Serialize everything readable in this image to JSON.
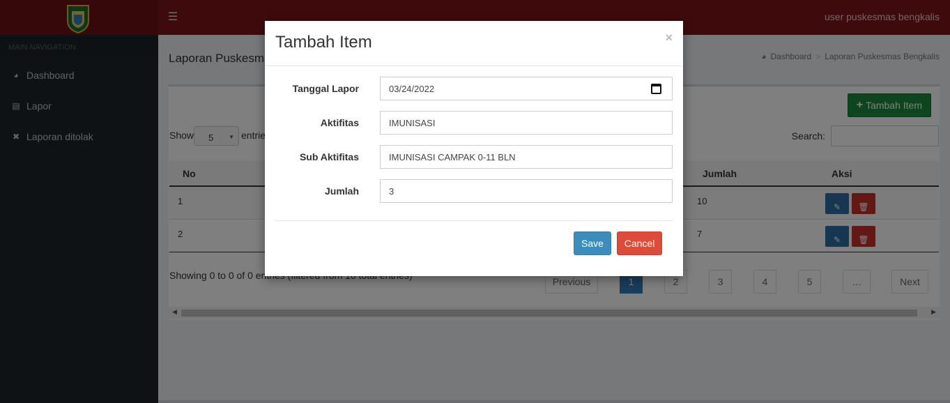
{
  "header": {
    "user_name": "user puskesmas bengkalis",
    "menu_icon": "hamburger-icon"
  },
  "sidebar": {
    "section_title": "MAIN NAVIGATION",
    "items": [
      {
        "label": "Dashboard",
        "icon": "dashboard-icon"
      },
      {
        "label": "Lapor",
        "icon": "newspaper-icon"
      },
      {
        "label": "Laporan ditolak",
        "icon": "close-icon"
      }
    ]
  },
  "content": {
    "title": "Laporan Puskesmas Bengkalis",
    "breadcrumb": [
      "Dashboard",
      "Laporan Puskesmas Bengkalis"
    ],
    "add_button": "Tambah Item",
    "show_label": "Show",
    "page_size": "5",
    "entries_label": "entries",
    "search_label": "Search:",
    "table": {
      "headers": [
        "No",
        "Jumlah",
        "Aksi"
      ],
      "rows": [
        {
          "no": "1",
          "jumlah": "10"
        },
        {
          "no": "2",
          "jumlah": "7"
        }
      ]
    },
    "info": "Showing 0 to 0 of 0 entries (filtered from 10 total entries)",
    "pagination": [
      "Previous",
      "1",
      "2",
      "3",
      "4",
      "5",
      "…",
      "Next"
    ]
  },
  "modal": {
    "title": "Tambah Item",
    "close": "×",
    "fields": {
      "tanggal_lapor": {
        "label": "Tanggal Lapor",
        "value": "03/24/2022"
      },
      "aktifitas": {
        "label": "Aktifitas",
        "value": "IMUNISASI"
      },
      "sub_aktifitas": {
        "label": "Sub Aktifitas",
        "value": "IMUNISASI CAMPAK 0-11 BLN"
      },
      "jumlah": {
        "label": "Jumlah",
        "value": "3"
      }
    },
    "save_label": "Save",
    "cancel_label": "Cancel"
  },
  "colors": {
    "header": "#7f1419",
    "sidebar": "#1e2528",
    "primary": "#3c8dbc",
    "danger": "#dd4b39",
    "success": "#1b8a3d"
  }
}
